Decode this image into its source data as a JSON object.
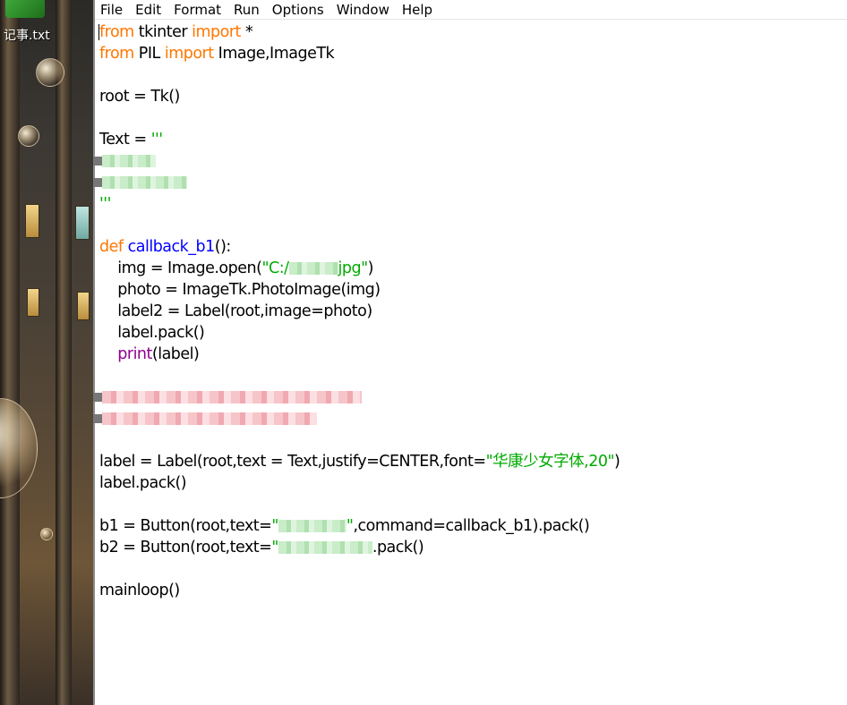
{
  "desktop": {
    "icon_label": "记事.txt",
    "icon_name": "text-file-icon"
  },
  "menu": [
    "File",
    "Edit",
    "Format",
    "Run",
    "Options",
    "Window",
    "Help"
  ],
  "code": {
    "l1": {
      "kw1": "from",
      "t1": " tkinter ",
      "kw2": "import",
      "t2": " *"
    },
    "l2": {
      "kw1": "from",
      "t1": " PIL ",
      "kw2": "import",
      "t2": " Image,ImageTk"
    },
    "l4": "root = Tk()",
    "l6": {
      "t1": "Text = ",
      "s1": "'''"
    },
    "l9": {
      "s1": "'''"
    },
    "l11": {
      "kw1": "def",
      "t1": " ",
      "fn": "callback_b1",
      "t2": "():"
    },
    "l12": {
      "t1": "    img = Image.open(",
      "s1": "\"C:/",
      "s2": "jpg\"",
      "t2": ")"
    },
    "l13": {
      "t1": "    photo = ImageTk.PhotoImage",
      "t2": "(img)"
    },
    "l14": "    label2 = Label(root,image=photo)",
    "l15": "    label.pack()",
    "l16": {
      "t0": "    ",
      "bi": "print",
      "t1": "(label)"
    },
    "l20": {
      "t1": "label = Label(root,text = Text,justify=CENTER,font=",
      "s1": "\"华康少女字体,20\"",
      "t2": ")"
    },
    "l21": "label.pack()",
    "l23": {
      "t1": "b1 = Button(root,text=",
      "s1": "\"",
      "s2": "\"",
      "t2": ",command=callback_b1).pack()"
    },
    "l24": {
      "t1": "b2 = Button(root,text=",
      "s1": "\"",
      "t2": ".pack()"
    },
    "l26": "mainloop()"
  },
  "colors": {
    "keyword": "#ff7700",
    "function_name": "#0000ff",
    "string": "#00aa00",
    "builtin": "#900090"
  }
}
